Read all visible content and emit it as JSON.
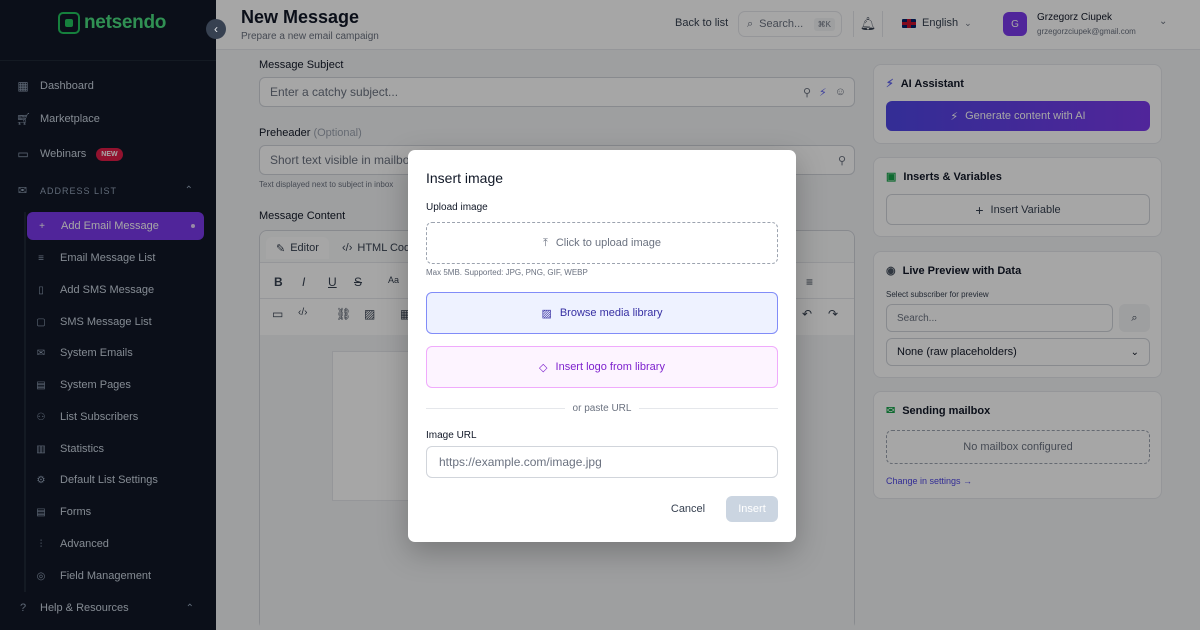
{
  "brand": {
    "name": "netsendo"
  },
  "sidebar": {
    "items": [
      {
        "label": "Dashboard"
      },
      {
        "label": "Marketplace"
      },
      {
        "label": "Webinars",
        "badge": "NEW"
      }
    ],
    "section": {
      "label": "ADDRESS LIST"
    },
    "sub_items": [
      {
        "label": "Add Email Message",
        "active": true
      },
      {
        "label": "Email Message List"
      },
      {
        "label": "Add SMS Message"
      },
      {
        "label": "SMS Message List"
      },
      {
        "label": "System Emails"
      },
      {
        "label": "System Pages"
      },
      {
        "label": "List Subscribers"
      },
      {
        "label": "Statistics"
      },
      {
        "label": "Default List Settings"
      },
      {
        "label": "Forms"
      },
      {
        "label": "Advanced"
      },
      {
        "label": "Field Management"
      }
    ],
    "help": {
      "label": "Help & Resources"
    }
  },
  "header": {
    "title": "New Message",
    "subtitle": "Prepare a new email campaign",
    "back_label": "Back to list",
    "search_placeholder": "Search...",
    "search_shortcut": "⌘K",
    "language": "English",
    "user": {
      "initial": "G",
      "name": "Grzegorz Ciupek",
      "email": "grzegorzciupek@gmail.com"
    }
  },
  "form": {
    "subject_label": "Message Subject",
    "subject_placeholder": "Enter a catchy subject...",
    "preheader_label": "Preheader",
    "preheader_optional": "(Optional)",
    "preheader_placeholder": "Short text visible in mailbox",
    "preheader_hint": "Text displayed next to subject in inbox",
    "content_label": "Message Content",
    "tabs": {
      "editor": "Editor",
      "html": "HTML Code"
    }
  },
  "panels": {
    "ai": {
      "title": "AI Assistant",
      "button": "Generate content with AI"
    },
    "inserts": {
      "title": "Inserts & Variables",
      "button": "Insert Variable"
    },
    "preview": {
      "title": "Live Preview with Data",
      "label": "Select subscriber for preview",
      "search_placeholder": "Search...",
      "select_value": "None (raw placeholders)"
    },
    "mailbox": {
      "title": "Sending mailbox",
      "empty": "No mailbox configured",
      "link": "Change in settings →"
    }
  },
  "modal": {
    "title": "Insert image",
    "upload_label": "Upload image",
    "upload_text": "Click to upload image",
    "upload_hint": "Max 5MB. Supported: JPG, PNG, GIF, WEBP",
    "browse_label": "Browse media library",
    "logo_label": "Insert logo from library",
    "or_text": "or paste URL",
    "url_label": "Image URL",
    "url_placeholder": "https://example.com/image.jpg",
    "cancel_label": "Cancel",
    "insert_label": "Insert"
  },
  "colors": {
    "accent": "#7c3aed",
    "sidebar_bg": "#111827",
    "brand": "#4ade80"
  }
}
